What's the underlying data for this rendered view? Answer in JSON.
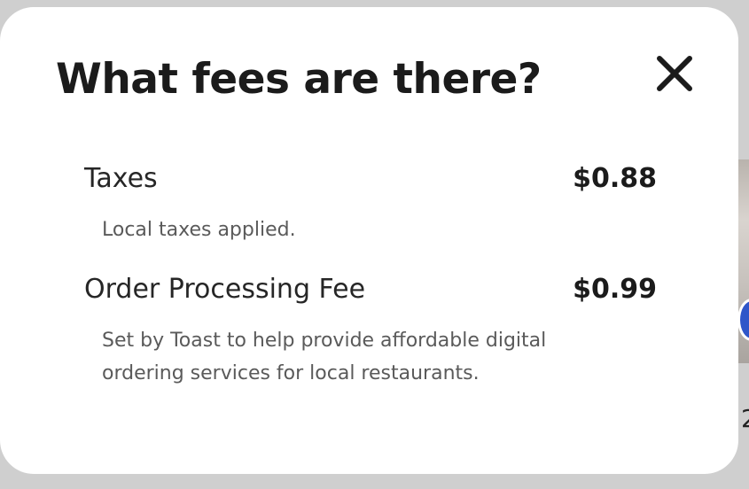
{
  "modal": {
    "title": "What fees are there?",
    "close_icon": "close-icon"
  },
  "fees": [
    {
      "name": "Taxes",
      "amount": "$0.88",
      "description": "Local taxes applied."
    },
    {
      "name": "Order Processing Fee",
      "amount": "$0.99",
      "description": "Set by Toast to help provide affordable digital ordering services for local restaurants."
    }
  ],
  "background_peek": {
    "text": "2"
  },
  "colors": {
    "overlay": "#cfcfcf",
    "modal_bg": "#ffffff",
    "title": "#1b1b1b",
    "description": "#5a5a5a",
    "accent": "#2f56c9"
  }
}
